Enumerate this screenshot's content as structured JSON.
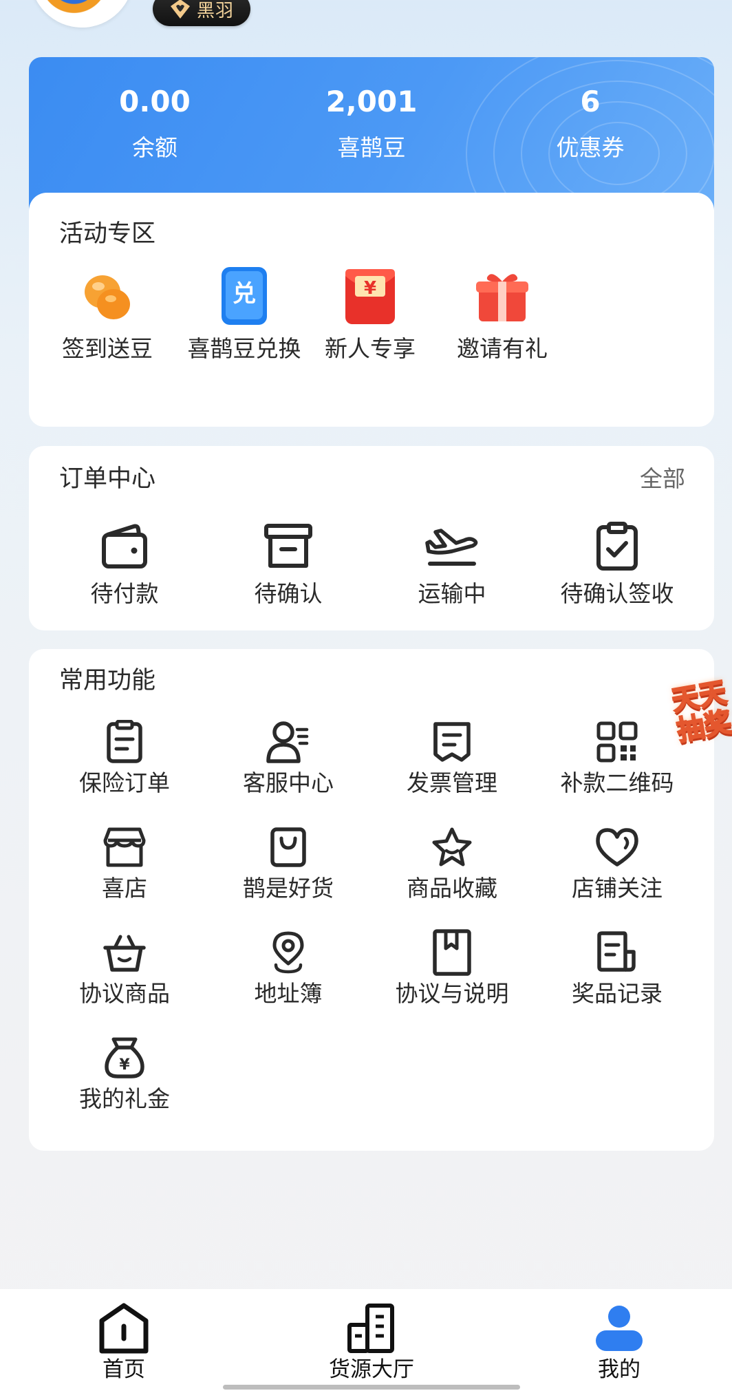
{
  "profile": {
    "badge_label": "黑羽"
  },
  "stats": [
    {
      "value": "0.00",
      "label": "余额"
    },
    {
      "value": "2,001",
      "label": "喜鹊豆"
    },
    {
      "value": "6",
      "label": "优惠券"
    }
  ],
  "activities": {
    "title": "活动专区",
    "items": [
      {
        "label": "签到送豆",
        "icon": "beans-icon"
      },
      {
        "label": "喜鹊豆兑换",
        "icon": "exchange-icon"
      },
      {
        "label": "新人专享",
        "icon": "red-envelope-icon"
      },
      {
        "label": "邀请有礼",
        "icon": "gift-icon"
      }
    ]
  },
  "orders": {
    "title": "订单中心",
    "more_label": "全部",
    "items": [
      {
        "label": "待付款",
        "icon": "wallet-icon"
      },
      {
        "label": "待确认",
        "icon": "archive-box-icon"
      },
      {
        "label": "运输中",
        "icon": "airplane-icon"
      },
      {
        "label": "待确认签收",
        "icon": "clipboard-check-icon"
      }
    ]
  },
  "functions": {
    "title": "常用功能",
    "items": [
      {
        "label": "保险订单",
        "icon": "document-icon"
      },
      {
        "label": "客服中心",
        "icon": "customer-service-icon"
      },
      {
        "label": "发票管理",
        "icon": "invoice-icon"
      },
      {
        "label": "补款二维码",
        "icon": "qr-code-icon"
      },
      {
        "label": "喜店",
        "icon": "store-icon"
      },
      {
        "label": "鹊是好货",
        "icon": "shopping-bag-icon"
      },
      {
        "label": "商品收藏",
        "icon": "star-icon"
      },
      {
        "label": "店铺关注",
        "icon": "heart-icon"
      },
      {
        "label": "协议商品",
        "icon": "basket-icon"
      },
      {
        "label": "地址簿",
        "icon": "location-pin-icon"
      },
      {
        "label": "协议与说明",
        "icon": "bookmark-book-icon"
      },
      {
        "label": "奖品记录",
        "icon": "record-icon"
      },
      {
        "label": "我的礼金",
        "icon": "money-bag-icon"
      }
    ]
  },
  "floating_promo": {
    "line1": "天天",
    "line2": "抽奖"
  },
  "tabbar": [
    {
      "label": "首页",
      "icon": "home-icon",
      "active": false
    },
    {
      "label": "货源大厅",
      "icon": "building-icon",
      "active": false
    },
    {
      "label": "我的",
      "icon": "user-icon",
      "active": true
    }
  ],
  "colors": {
    "accent": "#3b8cf2",
    "text": "#2a2a2a",
    "tab_active": "#2f7ef0"
  }
}
